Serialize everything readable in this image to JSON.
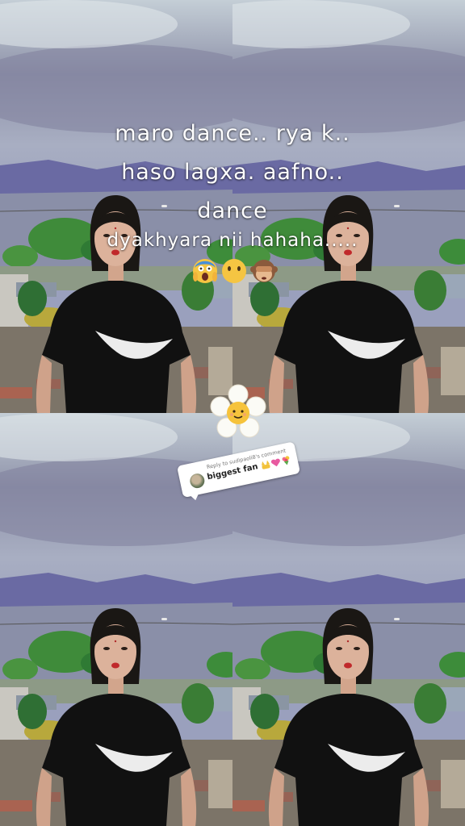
{
  "caption": {
    "line1": "maro dance.. rya k..",
    "line2": "haso lagxa. aafno..",
    "line3": "dance",
    "line4": "dyakhyara nii hahaha....."
  },
  "emojis": [
    "screaming-face-emoji",
    "face-without-mouth-emoji",
    "see-no-evil-monkey-emoji"
  ],
  "sticker": "smiling-flower-sticker",
  "reply_card": {
    "title": "Reply to sudipaoli8's comment",
    "text": "biggest fan",
    "emojis": [
      "raised-hands-emoji",
      "pink-heart-emoji",
      "bouquet-emoji"
    ]
  },
  "colors": {
    "sky": "#b7c3cc",
    "mountains": "#6d6fa6",
    "shirt": "#111111",
    "caption_text": "#ffffff"
  }
}
